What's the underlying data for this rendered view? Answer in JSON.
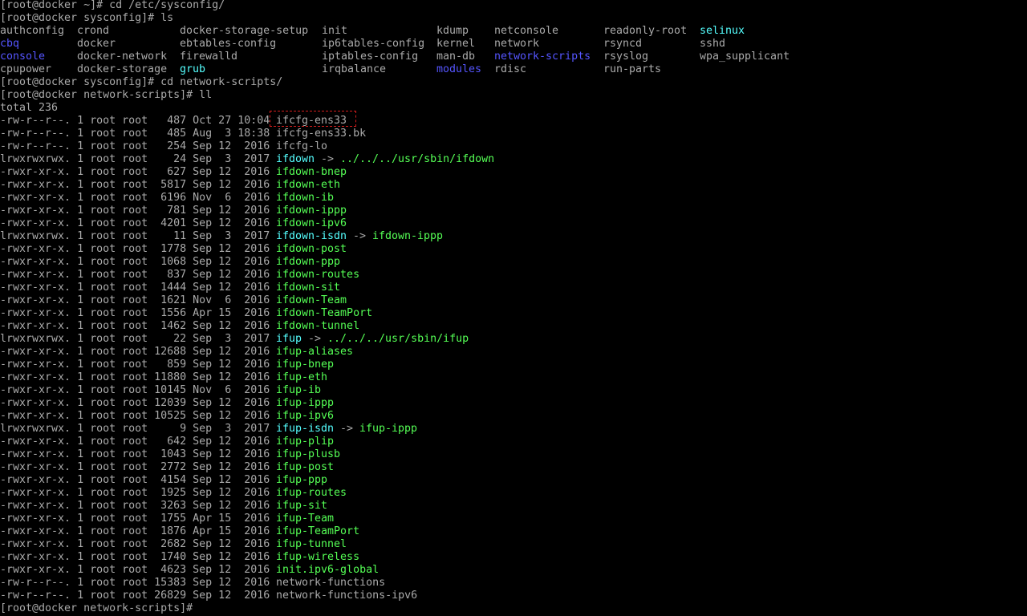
{
  "terminal": {
    "lines": [
      [
        {
          "t": "[root@docker ~]# cd /etc/sysconfig/",
          "c": "default"
        }
      ],
      [
        {
          "t": "[root@docker sysconfig]# ls",
          "c": "default"
        }
      ],
      [
        {
          "t": "authconfig",
          "c": "default"
        },
        {
          "t": "crond",
          "c": "default"
        },
        {
          "t": "docker-storage-setup",
          "c": "default"
        },
        {
          "t": "init",
          "c": "default"
        },
        {
          "t": "kdump",
          "c": "default"
        },
        {
          "t": "netconsole",
          "c": "default"
        },
        {
          "t": "readonly-root",
          "c": "default"
        },
        {
          "t": "selinux",
          "c": "link"
        }
      ],
      [
        {
          "t": "cbq",
          "c": "dir"
        },
        {
          "t": "docker",
          "c": "default"
        },
        {
          "t": "ebtables-config",
          "c": "default"
        },
        {
          "t": "ip6tables-config",
          "c": "default"
        },
        {
          "t": "kernel",
          "c": "default"
        },
        {
          "t": "network",
          "c": "default"
        },
        {
          "t": "rsyncd",
          "c": "default"
        },
        {
          "t": "sshd",
          "c": "default"
        }
      ],
      [
        {
          "t": "console",
          "c": "dir"
        },
        {
          "t": "docker-network",
          "c": "default"
        },
        {
          "t": "firewalld",
          "c": "default"
        },
        {
          "t": "iptables-config",
          "c": "default"
        },
        {
          "t": "man-db",
          "c": "default"
        },
        {
          "t": "network-scripts",
          "c": "dir"
        },
        {
          "t": "rsyslog",
          "c": "default"
        },
        {
          "t": "wpa_supplicant",
          "c": "default"
        }
      ],
      [
        {
          "t": "cpupower",
          "c": "default"
        },
        {
          "t": "docker-storage",
          "c": "default"
        },
        {
          "t": "grub",
          "c": "link"
        },
        {
          "t": "irqbalance",
          "c": "default"
        },
        {
          "t": "modules",
          "c": "dir"
        },
        {
          "t": "rdisc",
          "c": "default"
        },
        {
          "t": "run-parts",
          "c": "default"
        }
      ],
      [
        {
          "t": "[root@docker sysconfig]# cd network-scripts/",
          "c": "default"
        }
      ],
      [
        {
          "t": "[root@docker network-scripts]# ll",
          "c": "default"
        }
      ],
      [
        {
          "t": "total 236",
          "c": "default"
        }
      ],
      [
        {
          "t": "-rw-r--r--. 1 root root   487 Oct 27 10:04 ",
          "c": "default"
        },
        {
          "t": "ifcfg-ens33",
          "c": "default"
        }
      ],
      [
        {
          "t": "-rw-r--r--. 1 root root   485 Aug  3 18:38 ",
          "c": "default"
        },
        {
          "t": "ifcfg-ens33.bk",
          "c": "default"
        }
      ],
      [
        {
          "t": "-rw-r--r--. 1 root root   254 Sep 12  2016 ",
          "c": "default"
        },
        {
          "t": "ifcfg-lo",
          "c": "default"
        }
      ],
      [
        {
          "t": "lrwxrwxrwx. 1 root root    24 Sep  3  2017 ",
          "c": "default"
        },
        {
          "t": "ifdown",
          "c": "link"
        },
        {
          "t": " -> ",
          "c": "default"
        },
        {
          "t": "../../../usr/sbin/ifdown",
          "c": "exec"
        }
      ],
      [
        {
          "t": "-rwxr-xr-x. 1 root root   627 Sep 12  2016 ",
          "c": "default"
        },
        {
          "t": "ifdown-bnep",
          "c": "exec"
        }
      ],
      [
        {
          "t": "-rwxr-xr-x. 1 root root  5817 Sep 12  2016 ",
          "c": "default"
        },
        {
          "t": "ifdown-eth",
          "c": "exec"
        }
      ],
      [
        {
          "t": "-rwxr-xr-x. 1 root root  6196 Nov  6  2016 ",
          "c": "default"
        },
        {
          "t": "ifdown-ib",
          "c": "exec"
        }
      ],
      [
        {
          "t": "-rwxr-xr-x. 1 root root   781 Sep 12  2016 ",
          "c": "default"
        },
        {
          "t": "ifdown-ippp",
          "c": "exec"
        }
      ],
      [
        {
          "t": "-rwxr-xr-x. 1 root root  4201 Sep 12  2016 ",
          "c": "default"
        },
        {
          "t": "ifdown-ipv6",
          "c": "exec"
        }
      ],
      [
        {
          "t": "lrwxrwxrwx. 1 root root    11 Sep  3  2017 ",
          "c": "default"
        },
        {
          "t": "ifdown-isdn",
          "c": "link"
        },
        {
          "t": " -> ",
          "c": "default"
        },
        {
          "t": "ifdown-ippp",
          "c": "exec"
        }
      ],
      [
        {
          "t": "-rwxr-xr-x. 1 root root  1778 Sep 12  2016 ",
          "c": "default"
        },
        {
          "t": "ifdown-post",
          "c": "exec"
        }
      ],
      [
        {
          "t": "-rwxr-xr-x. 1 root root  1068 Sep 12  2016 ",
          "c": "default"
        },
        {
          "t": "ifdown-ppp",
          "c": "exec"
        }
      ],
      [
        {
          "t": "-rwxr-xr-x. 1 root root   837 Sep 12  2016 ",
          "c": "default"
        },
        {
          "t": "ifdown-routes",
          "c": "exec"
        }
      ],
      [
        {
          "t": "-rwxr-xr-x. 1 root root  1444 Sep 12  2016 ",
          "c": "default"
        },
        {
          "t": "ifdown-sit",
          "c": "exec"
        }
      ],
      [
        {
          "t": "-rwxr-xr-x. 1 root root  1621 Nov  6  2016 ",
          "c": "default"
        },
        {
          "t": "ifdown-Team",
          "c": "exec"
        }
      ],
      [
        {
          "t": "-rwxr-xr-x. 1 root root  1556 Apr 15  2016 ",
          "c": "default"
        },
        {
          "t": "ifdown-TeamPort",
          "c": "exec"
        }
      ],
      [
        {
          "t": "-rwxr-xr-x. 1 root root  1462 Sep 12  2016 ",
          "c": "default"
        },
        {
          "t": "ifdown-tunnel",
          "c": "exec"
        }
      ],
      [
        {
          "t": "lrwxrwxrwx. 1 root root    22 Sep  3  2017 ",
          "c": "default"
        },
        {
          "t": "ifup",
          "c": "link"
        },
        {
          "t": " -> ",
          "c": "default"
        },
        {
          "t": "../../../usr/sbin/ifup",
          "c": "exec"
        }
      ],
      [
        {
          "t": "-rwxr-xr-x. 1 root root 12688 Sep 12  2016 ",
          "c": "default"
        },
        {
          "t": "ifup-aliases",
          "c": "exec"
        }
      ],
      [
        {
          "t": "-rwxr-xr-x. 1 root root   859 Sep 12  2016 ",
          "c": "default"
        },
        {
          "t": "ifup-bnep",
          "c": "exec"
        }
      ],
      [
        {
          "t": "-rwxr-xr-x. 1 root root 11880 Sep 12  2016 ",
          "c": "default"
        },
        {
          "t": "ifup-eth",
          "c": "exec"
        }
      ],
      [
        {
          "t": "-rwxr-xr-x. 1 root root 10145 Nov  6  2016 ",
          "c": "default"
        },
        {
          "t": "ifup-ib",
          "c": "exec"
        }
      ],
      [
        {
          "t": "-rwxr-xr-x. 1 root root 12039 Sep 12  2016 ",
          "c": "default"
        },
        {
          "t": "ifup-ippp",
          "c": "exec"
        }
      ],
      [
        {
          "t": "-rwxr-xr-x. 1 root root 10525 Sep 12  2016 ",
          "c": "default"
        },
        {
          "t": "ifup-ipv6",
          "c": "exec"
        }
      ],
      [
        {
          "t": "lrwxrwxrwx. 1 root root     9 Sep  3  2017 ",
          "c": "default"
        },
        {
          "t": "ifup-isdn",
          "c": "link"
        },
        {
          "t": " -> ",
          "c": "default"
        },
        {
          "t": "ifup-ippp",
          "c": "exec"
        }
      ],
      [
        {
          "t": "-rwxr-xr-x. 1 root root   642 Sep 12  2016 ",
          "c": "default"
        },
        {
          "t": "ifup-plip",
          "c": "exec"
        }
      ],
      [
        {
          "t": "-rwxr-xr-x. 1 root root  1043 Sep 12  2016 ",
          "c": "default"
        },
        {
          "t": "ifup-plusb",
          "c": "exec"
        }
      ],
      [
        {
          "t": "-rwxr-xr-x. 1 root root  2772 Sep 12  2016 ",
          "c": "default"
        },
        {
          "t": "ifup-post",
          "c": "exec"
        }
      ],
      [
        {
          "t": "-rwxr-xr-x. 1 root root  4154 Sep 12  2016 ",
          "c": "default"
        },
        {
          "t": "ifup-ppp",
          "c": "exec"
        }
      ],
      [
        {
          "t": "-rwxr-xr-x. 1 root root  1925 Sep 12  2016 ",
          "c": "default"
        },
        {
          "t": "ifup-routes",
          "c": "exec"
        }
      ],
      [
        {
          "t": "-rwxr-xr-x. 1 root root  3263 Sep 12  2016 ",
          "c": "default"
        },
        {
          "t": "ifup-sit",
          "c": "exec"
        }
      ],
      [
        {
          "t": "-rwxr-xr-x. 1 root root  1755 Apr 15  2016 ",
          "c": "default"
        },
        {
          "t": "ifup-Team",
          "c": "exec"
        }
      ],
      [
        {
          "t": "-rwxr-xr-x. 1 root root  1876 Apr 15  2016 ",
          "c": "default"
        },
        {
          "t": "ifup-TeamPort",
          "c": "exec"
        }
      ],
      [
        {
          "t": "-rwxr-xr-x. 1 root root  2682 Sep 12  2016 ",
          "c": "default"
        },
        {
          "t": "ifup-tunnel",
          "c": "exec"
        }
      ],
      [
        {
          "t": "-rwxr-xr-x. 1 root root  1740 Sep 12  2016 ",
          "c": "default"
        },
        {
          "t": "ifup-wireless",
          "c": "exec"
        }
      ],
      [
        {
          "t": "-rwxr-xr-x. 1 root root  4623 Sep 12  2016 ",
          "c": "default"
        },
        {
          "t": "init.ipv6-global",
          "c": "exec"
        }
      ],
      [
        {
          "t": "-rw-r--r--. 1 root root 15383 Sep 12  2016 ",
          "c": "default"
        },
        {
          "t": "network-functions",
          "c": "default"
        }
      ],
      [
        {
          "t": "-rw-r--r--. 1 root root 26829 Sep 12  2016 ",
          "c": "default"
        },
        {
          "t": "network-functions-ipv6",
          "c": "default"
        }
      ],
      [
        {
          "t": "[root@docker network-scripts]# ",
          "c": "default"
        }
      ]
    ]
  },
  "colors": {
    "background": "#000000",
    "default_text": "#aaaaaa",
    "directory": "#5555ff",
    "symlink": "#55ffff",
    "executable": "#55ff55",
    "highlight_box": "#d41d1d"
  }
}
